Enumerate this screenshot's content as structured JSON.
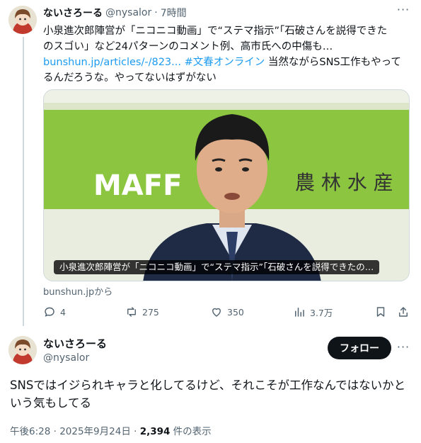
{
  "tweet1": {
    "name": "ないさろーる",
    "handle": "@nysalor",
    "dot": "·",
    "time": "7時間",
    "text_line1": "小泉進次郎陣営が「ニコニコ動画」で“ステマ指示”「石破さんを説得できた",
    "text_line2": "のスゴい」など24パターンのコメント例、高市氏への中傷も…",
    "link": "bunshun.jp/articles/-/823...",
    "hashtag": "#文春オンライン",
    "text_tail1": " 当然ながらSNS工作もやって",
    "text_tail2": "るんだろうな。やってないはずがない",
    "card_caption": "小泉進次郎陣営が「ニコニコ動画」で“ステマ指示”「石破さんを説得できたの…",
    "card_source": "bunshun.jpから",
    "card_sign_latin": "MAFF",
    "card_sign_kanji": "農 林 水 産",
    "replies": "4",
    "reposts": "275",
    "likes": "350",
    "views": "3.7万"
  },
  "tweet2": {
    "name": "ないさろーる",
    "handle": "@nysalor",
    "follow_label": "フォロー",
    "text": "SNSではイジられキャラと化してるけど、それこそが工作なんではないかという気もしてる",
    "time": "午後6:28 · 2025年9月24日 · ",
    "views": "2,394",
    "views_suffix": " 件の表示"
  },
  "more_label": "···",
  "colors": {
    "accent": "#1d9bf0",
    "text": "#0f1419",
    "muted": "#536471",
    "card_green": "#8cc540"
  },
  "icons": [
    "more-icon",
    "reply-icon",
    "repost-icon",
    "like-icon",
    "views-icon",
    "bookmark-icon",
    "share-icon"
  ]
}
